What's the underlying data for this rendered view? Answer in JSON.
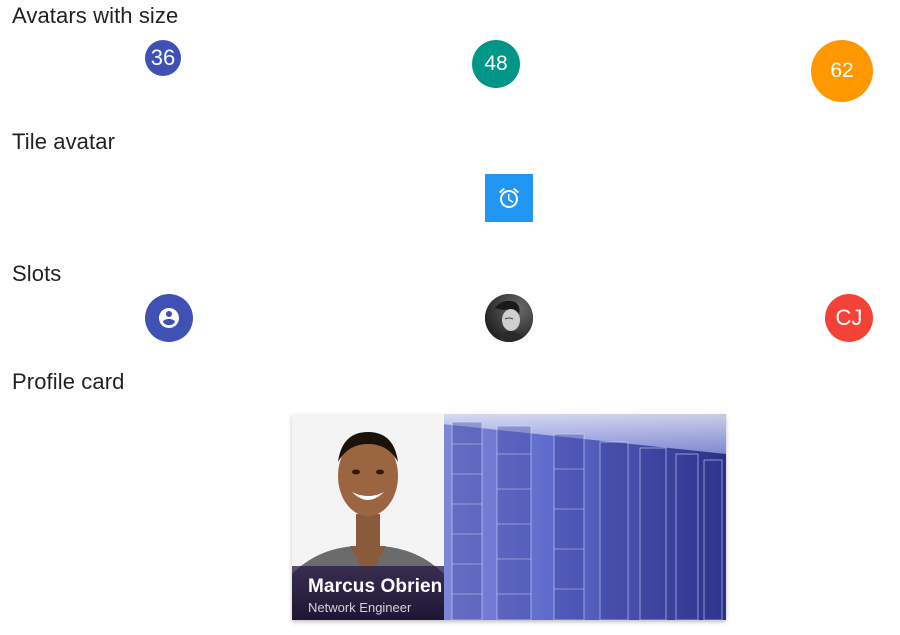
{
  "sections": {
    "sizes": {
      "title": "Avatars with size",
      "avatars": [
        {
          "label": "36",
          "color": "#3f51b5"
        },
        {
          "label": "48",
          "color": "#009688"
        },
        {
          "label": "62",
          "color": "#ff9800"
        }
      ]
    },
    "tile": {
      "title": "Tile avatar",
      "icon": "alarm-icon",
      "color": "#2196f3"
    },
    "slots": {
      "title": "Slots",
      "items": [
        {
          "type": "icon",
          "icon": "account-circle-icon",
          "color": "#3f51b5"
        },
        {
          "type": "image",
          "description": "portrait photo"
        },
        {
          "type": "text",
          "label": "CJ",
          "color": "#f44336"
        }
      ]
    },
    "profile": {
      "title": "Profile card",
      "name": "Marcus Obrien",
      "role": "Network Engineer"
    }
  }
}
